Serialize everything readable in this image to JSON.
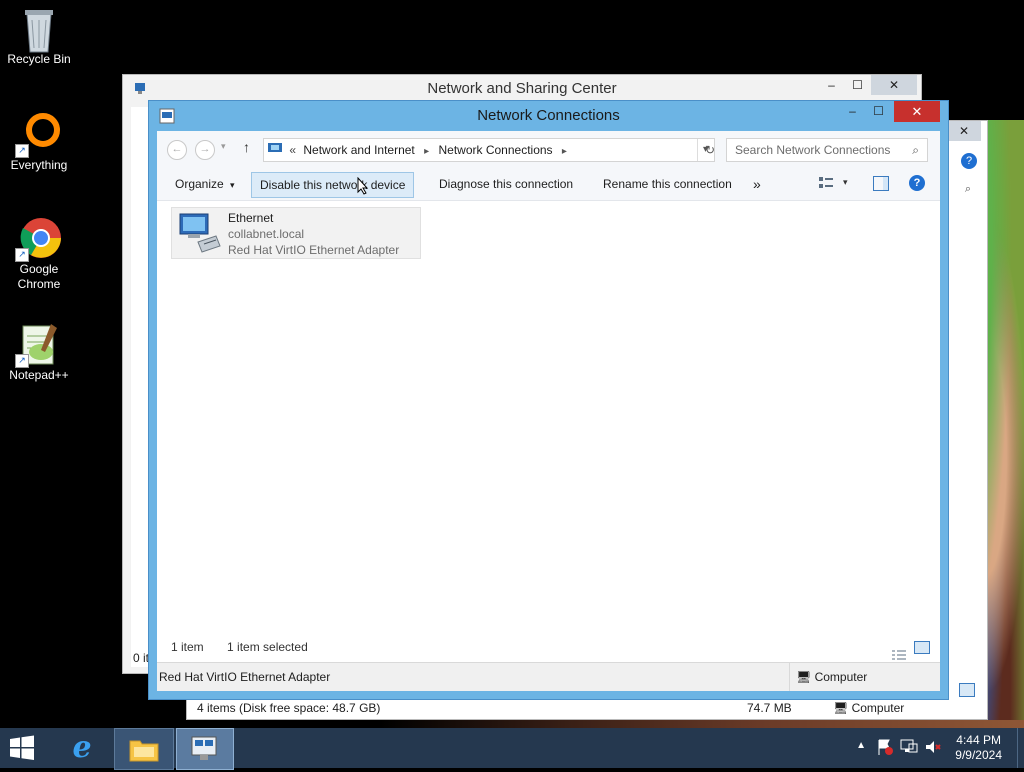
{
  "desktop": {
    "icons": [
      {
        "label": "Recycle Bin",
        "icon": "recycle-bin-icon"
      },
      {
        "label": "Everything",
        "icon": "everything-icon"
      },
      {
        "label": "Google Chrome",
        "icon": "chrome-icon"
      },
      {
        "label": "Notepad++",
        "icon": "notepadpp-icon"
      }
    ]
  },
  "back_window": {
    "title": "Network and Sharing Center",
    "status_left": "0 it"
  },
  "explorer_back": {
    "status_text": "4 items (Disk free space: 48.7 GB)",
    "size": "74.7 MB",
    "location": "Computer"
  },
  "main_window": {
    "title": "Network Connections",
    "address": {
      "prefix": "«",
      "crumb1": "Network and Internet",
      "crumb2": "Network Connections"
    },
    "search_placeholder": "Search Network Connections",
    "toolbar": {
      "organize": "Organize",
      "disable": "Disable this network device",
      "diagnose": "Diagnose this connection",
      "rename": "Rename this connection",
      "more": "»"
    },
    "connection": {
      "name": "Ethernet",
      "network": "collabnet.local",
      "adapter": "Red Hat VirtIO Ethernet Adapter"
    },
    "status": {
      "count": "1 item",
      "selected": "1 item selected",
      "detail": "Red Hat VirtIO Ethernet Adapter",
      "zone": "Computer"
    }
  },
  "taskbar": {
    "time": "4:44 PM",
    "date": "9/9/2024"
  },
  "colors": {
    "window_frame": "#6cb4e4",
    "close_red": "#c7302d",
    "taskbar": "#25384f",
    "toolbar_active": "#dcebf8"
  }
}
